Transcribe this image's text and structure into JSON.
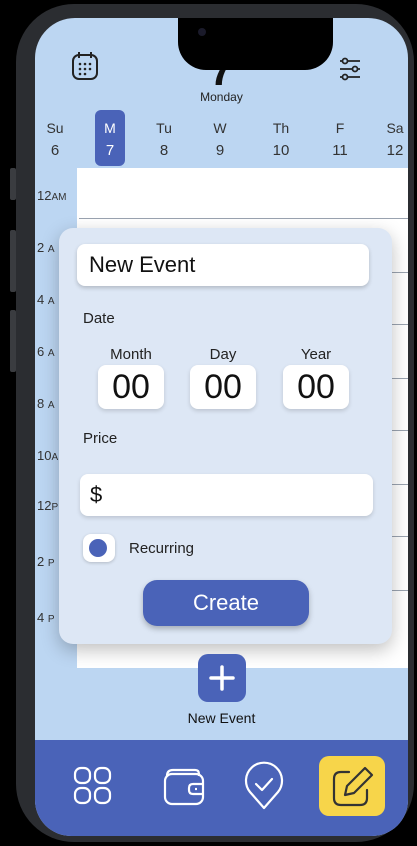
{
  "header": {
    "day_number": "7",
    "day_name": "Monday",
    "left_icon": "calendar-icon",
    "right_icon": "filter-sliders-icon"
  },
  "week": [
    {
      "abbr": "Su",
      "num": "6"
    },
    {
      "abbr": "M",
      "num": "7",
      "selected": true
    },
    {
      "abbr": "Tu",
      "num": "8"
    },
    {
      "abbr": "W",
      "num": "9"
    },
    {
      "abbr": "Th",
      "num": "10"
    },
    {
      "abbr": "F",
      "num": "11"
    },
    {
      "abbr": "Sa",
      "num": "12"
    }
  ],
  "hours": [
    "12",
    "2",
    "4",
    "6",
    "8",
    "10",
    "12",
    "2",
    "4"
  ],
  "hour_suffixes": [
    "AM",
    "A",
    "A",
    "A",
    "A",
    "A",
    "P",
    "P",
    "P"
  ],
  "modal": {
    "title_value": "New Event",
    "date_label": "Date",
    "month_label": "Month",
    "day_label": "Day",
    "year_label": "Year",
    "month_value": "00",
    "day_value": "00",
    "year_value": "00",
    "price_label": "Price",
    "price_prefix": "$",
    "recurring_label": "Recurring",
    "create_label": "Create"
  },
  "new_event": {
    "label": "New Event",
    "icon": "plus-icon"
  },
  "tabbar": {
    "items": [
      {
        "icon": "grid-icon"
      },
      {
        "icon": "wallet-icon"
      },
      {
        "icon": "map-pin-check-icon"
      },
      {
        "icon": "edit-icon",
        "active": true
      }
    ],
    "active_color": "#f7d54a"
  },
  "colors": {
    "accent": "#4a63b8",
    "background": "#bcd6f2",
    "modal": "#dde7f5"
  }
}
